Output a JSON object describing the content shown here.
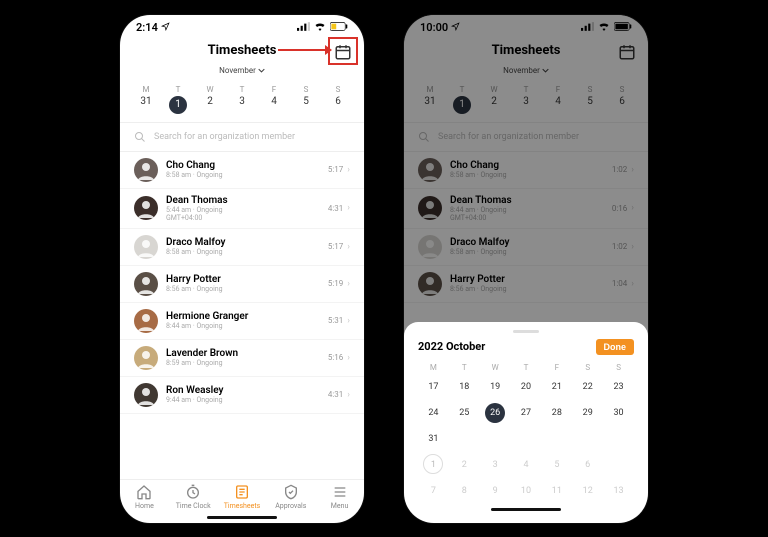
{
  "phone1": {
    "status": {
      "time": "2:14",
      "loc_icon": "location",
      "signal": "•••",
      "wifi": "wifi",
      "battery": "low"
    },
    "header": {
      "title": "Timesheets",
      "month": "November"
    },
    "week": [
      {
        "d": "M",
        "n": "31"
      },
      {
        "d": "T",
        "n": "1",
        "selected": true
      },
      {
        "d": "W",
        "n": "2"
      },
      {
        "d": "T",
        "n": "3"
      },
      {
        "d": "F",
        "n": "4"
      },
      {
        "d": "S",
        "n": "5"
      },
      {
        "d": "S",
        "n": "6"
      }
    ],
    "search_placeholder": "Search for an organization member",
    "members": [
      {
        "name": "Cho Chang",
        "sub": "8:58 am · Ongoing",
        "dur": "5:17"
      },
      {
        "name": "Dean Thomas",
        "sub": "5:44 am · Ongoing",
        "sub2": "GMT+04:00",
        "dur": "4:31"
      },
      {
        "name": "Draco Malfoy",
        "sub": "8:58 am · Ongoing",
        "dur": "5:17"
      },
      {
        "name": "Harry Potter",
        "sub": "8:56 am · Ongoing",
        "dur": "5:19"
      },
      {
        "name": "Hermione Granger",
        "sub": "8:44 am · Ongoing",
        "dur": "5:31"
      },
      {
        "name": "Lavender Brown",
        "sub": "8:59 am · Ongoing",
        "dur": "5:16"
      },
      {
        "name": "Ron Weasley",
        "sub": "9:44 am · Ongoing",
        "dur": "4:31"
      }
    ],
    "tabs": [
      {
        "label": "Home"
      },
      {
        "label": "Time Clock"
      },
      {
        "label": "Timesheets",
        "active": true
      },
      {
        "label": "Approvals"
      },
      {
        "label": "Menu"
      }
    ]
  },
  "phone2": {
    "status": {
      "time": "10:00",
      "loc_icon": "location"
    },
    "header": {
      "title": "Timesheets",
      "month": "November"
    },
    "week_same": true,
    "search_placeholder": "Search for an organization member",
    "members": [
      {
        "name": "Cho Chang",
        "sub": "8:58 am · Ongoing",
        "dur": "1:02"
      },
      {
        "name": "Dean Thomas",
        "sub": "8:44 am · Ongoing",
        "sub2": "GMT+04:00",
        "dur": "0:16"
      },
      {
        "name": "Draco Malfoy",
        "sub": "8:58 am · Ongoing",
        "dur": "1:02"
      },
      {
        "name": "Harry Potter",
        "sub": "8:56 am · Ongoing",
        "dur": "1:04"
      }
    ],
    "sheet": {
      "title": "2022 October",
      "done": "Done",
      "weekdays": [
        "M",
        "T",
        "W",
        "T",
        "F",
        "S",
        "S"
      ],
      "cells": [
        {
          "n": "17"
        },
        {
          "n": "18"
        },
        {
          "n": "19"
        },
        {
          "n": "20"
        },
        {
          "n": "21"
        },
        {
          "n": "22"
        },
        {
          "n": "23"
        },
        {
          "n": "24"
        },
        {
          "n": "25"
        },
        {
          "n": "26",
          "sel": true
        },
        {
          "n": "27"
        },
        {
          "n": "28"
        },
        {
          "n": "29"
        },
        {
          "n": "30"
        },
        {
          "n": "31"
        },
        {
          "n": "",
          "blank": true
        },
        {
          "n": "",
          "blank": true
        },
        {
          "n": "",
          "blank": true
        },
        {
          "n": "",
          "blank": true
        },
        {
          "n": "",
          "blank": true
        },
        {
          "n": "",
          "blank": true
        },
        {
          "n": "1",
          "ring": true,
          "faded": true
        },
        {
          "n": "2",
          "faded": true
        },
        {
          "n": "3",
          "faded": true
        },
        {
          "n": "4",
          "faded": true
        },
        {
          "n": "5",
          "faded": true
        },
        {
          "n": "6",
          "faded": true
        },
        {
          "n": "",
          "blank": true
        },
        {
          "n": "7",
          "faded": true
        },
        {
          "n": "8",
          "faded": true
        },
        {
          "n": "9",
          "faded": true
        },
        {
          "n": "10",
          "faded": true
        },
        {
          "n": "11",
          "faded": true
        },
        {
          "n": "12",
          "faded": true
        },
        {
          "n": "13",
          "faded": true
        }
      ]
    }
  },
  "avatar_colors": [
    "#6b5f5a",
    "#3b2e2a",
    "#d8d6d2",
    "#5a4f46",
    "#a76b45",
    "#c7ab7b",
    "#403832"
  ]
}
